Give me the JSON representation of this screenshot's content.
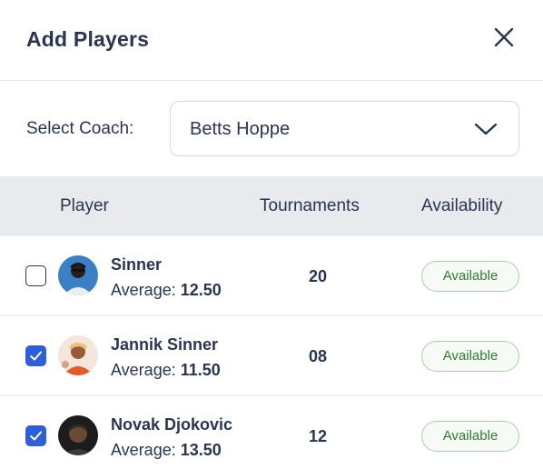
{
  "dialog": {
    "title": "Add Players",
    "close_icon": "close-icon"
  },
  "coach": {
    "label": "Select Coach:",
    "selected": "Betts Hoppe"
  },
  "table": {
    "columns": [
      "Player",
      "Tournaments",
      "Availability"
    ],
    "rows": [
      {
        "checked": false,
        "name": "Sinner",
        "average_label": "Average:",
        "average": "12.50",
        "tournaments": "20",
        "availability": "Available"
      },
      {
        "checked": true,
        "name": "Jannik Sinner",
        "average_label": "Average:",
        "average": "11.50",
        "tournaments": "08",
        "availability": "Available"
      },
      {
        "checked": true,
        "name": "Novak Djokovic",
        "average_label": "Average:",
        "average": "13.50",
        "tournaments": "12",
        "availability": "Available"
      }
    ]
  },
  "colors": {
    "accent": "#2f5fd8",
    "available_text": "#2e7d32",
    "available_border": "#a8cfa9",
    "header_bg": "#e8eaee"
  }
}
